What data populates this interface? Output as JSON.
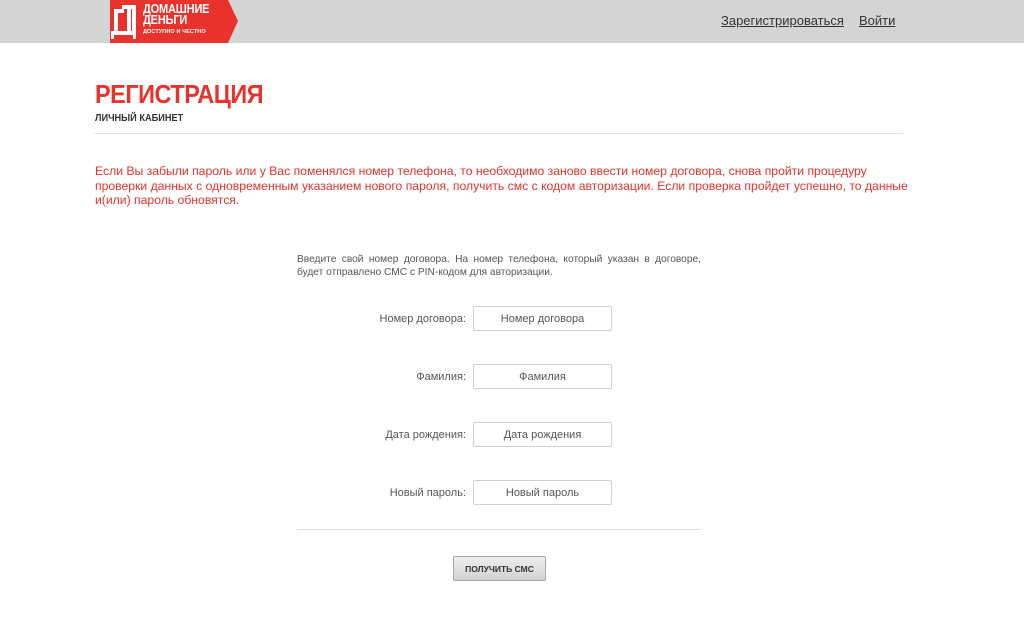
{
  "header": {
    "logo": {
      "line1": "ДОМАШНИЕ",
      "line2": "ДЕНЬГИ",
      "tagline": "ДОСТУПНО И ЧЕСТНО",
      "brand_color": "#e8322b"
    },
    "register_link": "Зарегистрироваться",
    "login_link": "Войти"
  },
  "page": {
    "title": "РЕГИСТРАЦИЯ",
    "subtitle": "ЛИЧНЫЙ КАБИНЕТ",
    "warning": "Если Вы забыли пароль или у Вас поменялся номер телефона, то необходимо заново ввести номер договора, снова пройти процедуру проверки данных с одновременным указанием нового пароля, получить смс с кодом авторизации. Если проверка пройдет успешно, то данные и(или) пароль обновятся."
  },
  "form": {
    "intro": "Введите свой номер договора. На номер телефона, который указан в договоре, будет отправлено СМС с PIN-кодом для авторизации.",
    "contract": {
      "label": "Номер договора:",
      "placeholder": "Номер договора",
      "value": ""
    },
    "surname": {
      "label": "Фамилия:",
      "placeholder": "Фамилия",
      "value": ""
    },
    "birthdate": {
      "label": "Дата рождения:",
      "placeholder": "Дата рождения",
      "value": ""
    },
    "password": {
      "label": "Новый пароль:",
      "placeholder": "Новый пароль",
      "value": ""
    },
    "submit_label": "ПОЛУЧИТЬ СМС"
  }
}
